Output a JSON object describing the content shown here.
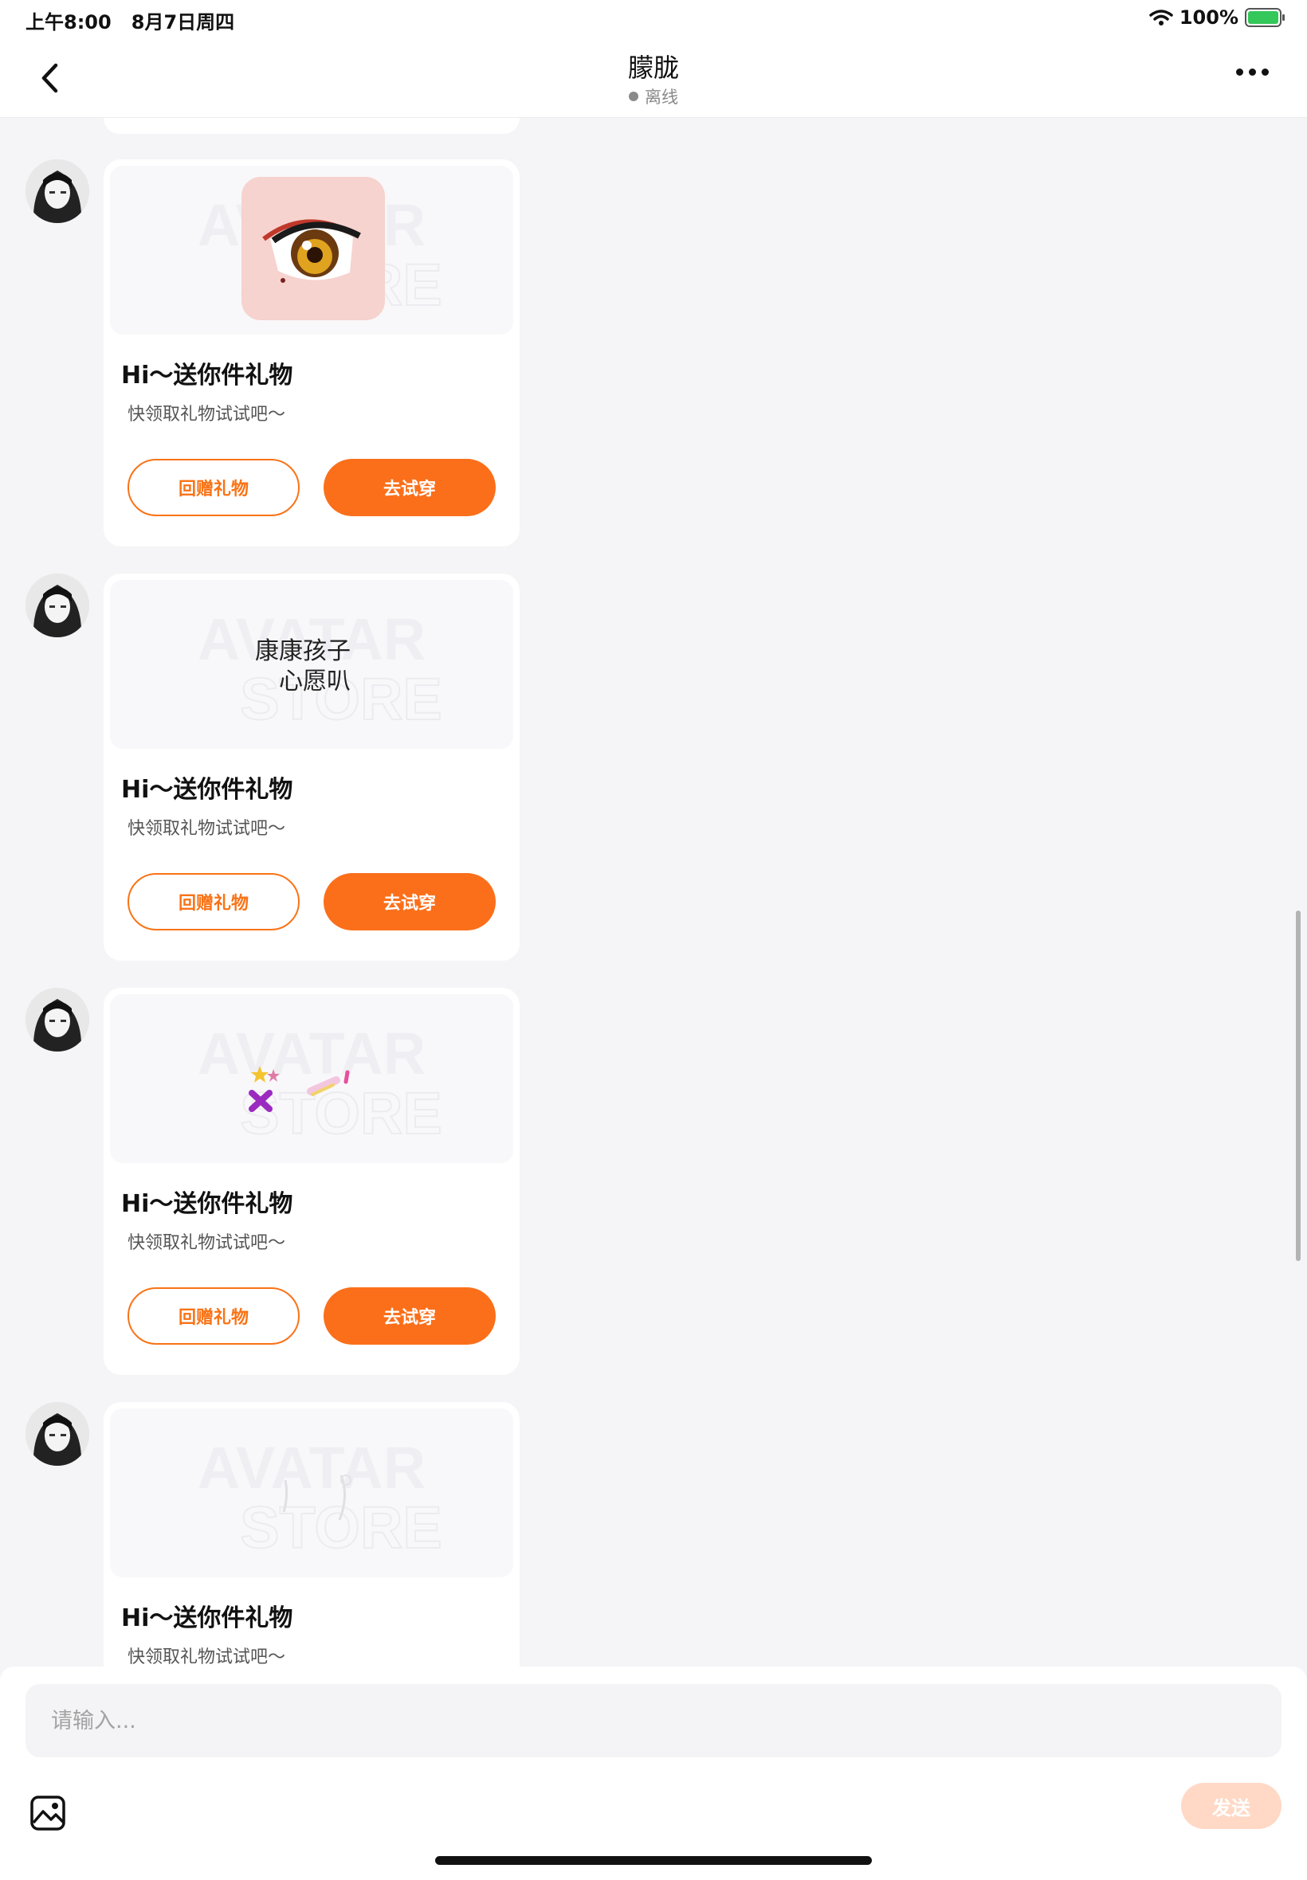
{
  "status_bar": {
    "time": "上午8:00   8月7日周四",
    "battery": "100%"
  },
  "nav": {
    "title": "朦胧",
    "status": "离线"
  },
  "messages": [
    {
      "gift_text_1": "",
      "title": "Hi～送你件礼物",
      "desc": "快领取礼物试试吧～",
      "return_gift": "回赠礼物",
      "try_on": "去试穿"
    },
    {
      "gift_text_1": "康康孩子",
      "gift_text_2": "心愿叭",
      "title": "Hi～送你件礼物",
      "desc": "快领取礼物试试吧～",
      "return_gift": "回赠礼物",
      "try_on": "去试穿"
    },
    {
      "title": "Hi～送你件礼物",
      "desc": "快领取礼物试试吧～",
      "return_gift": "回赠礼物",
      "try_on": "去试穿"
    },
    {
      "title": "Hi～送你件礼物",
      "desc": "快领取礼物试试吧～"
    }
  ],
  "watermark": {
    "line1": "AVATAR",
    "line2": "STORE"
  },
  "input": {
    "placeholder": "请输入...",
    "send": "发送"
  },
  "colors": {
    "accent": "#fb6f1a",
    "send_disabled": "#ffd9c6"
  },
  "icons": {
    "back": "chevron-left-icon",
    "more": "more-dots-icon",
    "image": "image-icon"
  }
}
